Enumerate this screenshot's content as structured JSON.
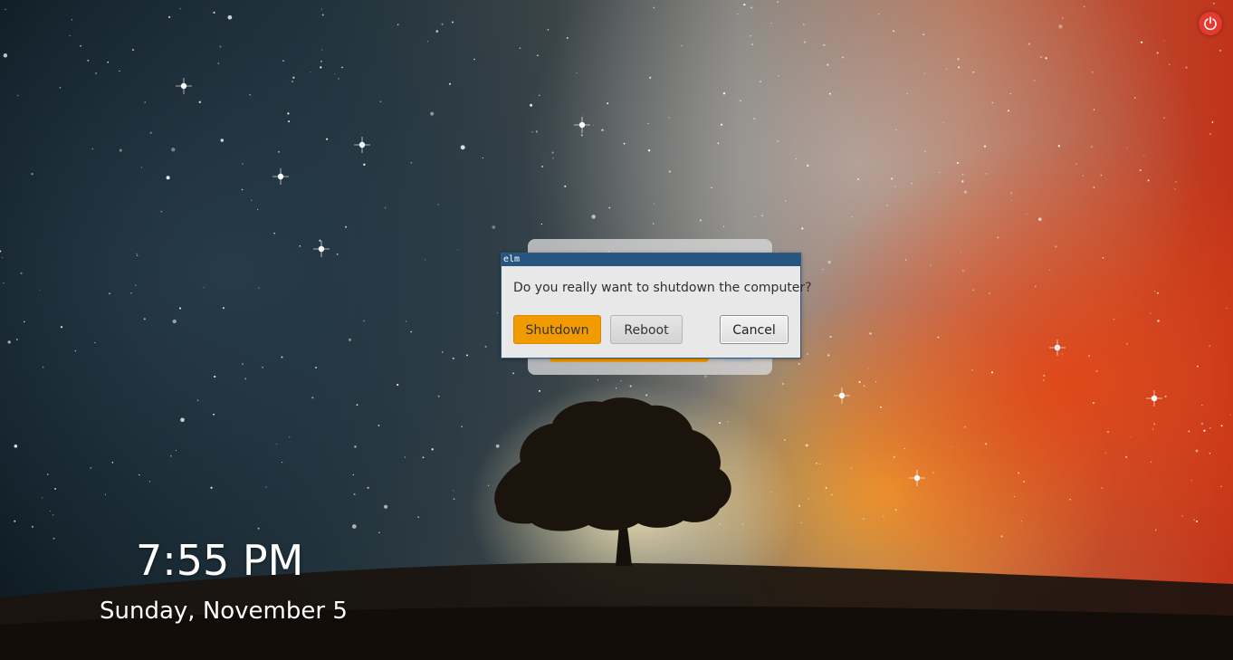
{
  "screen": {
    "wallpaper": "starry-sky-tree"
  },
  "topbar": {
    "power_icon": "power-icon",
    "power_color": "#e53a2f"
  },
  "lockscreen": {
    "time": "7:55 PM",
    "date": "Sunday, November 5"
  },
  "dialog": {
    "title": "elm",
    "message": "Do you really want to shutdown the computer?",
    "buttons": {
      "shutdown": "Shutdown",
      "reboot": "Reboot",
      "cancel": "Cancel"
    },
    "accent_color": "#f29b00",
    "titlebar_color": "#28557f"
  }
}
